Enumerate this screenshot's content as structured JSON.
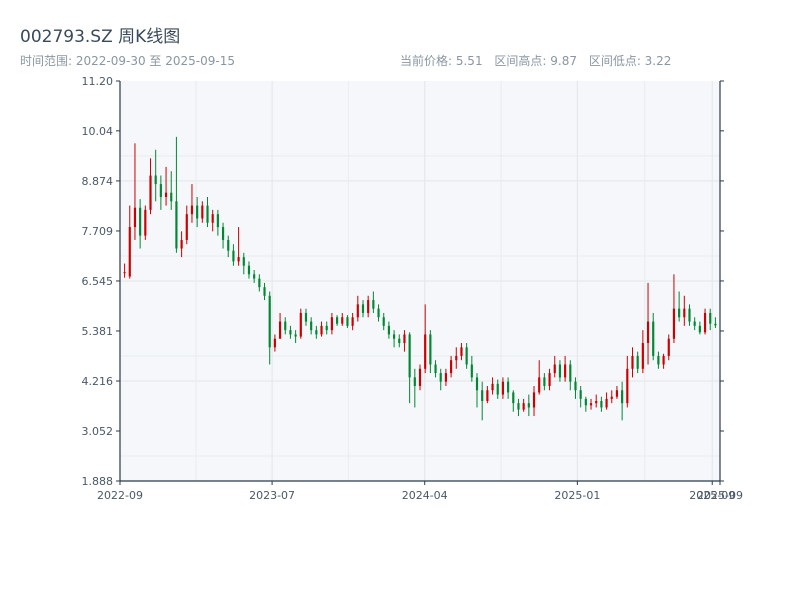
{
  "header": {
    "title": "002793.SZ 周K线图",
    "range_text": "时间范围: 2022-09-30 至 2025-09-15",
    "current_price_text": "当前价格: 5.51",
    "high_text": "区间高点: 9.87",
    "low_text": "区间低点: 3.22"
  },
  "chart_data": {
    "type": "candlestick",
    "title": "002793.SZ 周K线图",
    "xlabel": "",
    "ylabel": "",
    "ylim": [
      1.888,
      11.2
    ],
    "yticks": [
      1.888,
      3.052,
      4.216,
      5.381,
      6.545,
      7.709,
      8.874,
      10.04,
      11.2
    ],
    "ytick_labels": [
      "1.888",
      "3.052",
      "4.216",
      "5.381",
      "6.545",
      "7.709",
      "8.874",
      "10.04",
      "11.20"
    ],
    "date_range": [
      "2022-09-30",
      "2025-09-15"
    ],
    "xticks": [
      {
        "date": "2022-09-30",
        "label": "2022-09"
      },
      {
        "date": "2023-07-01",
        "label": "2023-07"
      },
      {
        "date": "2024-04-01",
        "label": "2024-04"
      },
      {
        "date": "2025-01-01",
        "label": "2025-01"
      },
      {
        "date": "2025-09-01",
        "label": "2025-09"
      },
      {
        "date": "2025-09-15",
        "label": "2025-09"
      }
    ],
    "up_color": "#cc0000",
    "down_color": "#008833",
    "grid": true,
    "candles": [
      [
        6.75,
        6.95,
        6.75,
        6.62
      ],
      [
        6.65,
        8.3,
        7.8,
        6.6
      ],
      [
        7.8,
        9.75,
        8.25,
        7.5
      ],
      [
        8.25,
        8.45,
        7.6,
        7.3
      ],
      [
        7.6,
        8.3,
        8.2,
        7.5
      ],
      [
        8.2,
        9.4,
        9.0,
        8.1
      ],
      [
        9.0,
        9.6,
        8.8,
        8.4
      ],
      [
        8.8,
        9.0,
        8.5,
        8.2
      ],
      [
        8.5,
        9.2,
        8.6,
        8.3
      ],
      [
        8.6,
        9.1,
        8.4,
        8.2
      ],
      [
        8.4,
        9.9,
        7.3,
        7.2
      ],
      [
        7.3,
        7.7,
        7.5,
        7.1
      ],
      [
        7.5,
        8.3,
        8.1,
        7.4
      ],
      [
        8.1,
        8.8,
        8.3,
        7.9
      ],
      [
        8.3,
        8.5,
        8.0,
        7.8
      ],
      [
        8.0,
        8.4,
        8.3,
        7.9
      ],
      [
        8.3,
        8.5,
        7.9,
        7.8
      ],
      [
        7.9,
        8.2,
        8.1,
        7.7
      ],
      [
        8.1,
        8.2,
        7.8,
        7.6
      ],
      [
        7.8,
        7.9,
        7.5,
        7.3
      ],
      [
        7.5,
        7.6,
        7.25,
        7.1
      ],
      [
        7.25,
        7.4,
        7.0,
        6.9
      ],
      [
        7.0,
        7.8,
        7.1,
        6.9
      ],
      [
        7.1,
        7.2,
        6.9,
        6.7
      ],
      [
        6.9,
        7.0,
        6.7,
        6.6
      ],
      [
        6.7,
        6.8,
        6.6,
        6.5
      ],
      [
        6.6,
        6.7,
        6.4,
        6.3
      ],
      [
        6.4,
        6.5,
        6.2,
        6.1
      ],
      [
        6.2,
        6.3,
        5.0,
        4.6
      ],
      [
        5.0,
        5.3,
        5.2,
        4.9
      ],
      [
        5.2,
        5.8,
        5.6,
        5.2
      ],
      [
        5.6,
        5.7,
        5.4,
        5.3
      ],
      [
        5.4,
        5.5,
        5.3,
        5.2
      ],
      [
        5.3,
        5.4,
        5.25,
        5.1
      ],
      [
        5.25,
        5.9,
        5.8,
        5.2
      ],
      [
        5.8,
        5.9,
        5.6,
        5.5
      ],
      [
        5.6,
        5.7,
        5.4,
        5.3
      ],
      [
        5.4,
        5.5,
        5.3,
        5.2
      ],
      [
        5.3,
        5.6,
        5.5,
        5.25
      ],
      [
        5.5,
        5.6,
        5.4,
        5.3
      ],
      [
        5.4,
        5.8,
        5.7,
        5.3
      ],
      [
        5.7,
        5.75,
        5.55,
        5.5
      ],
      [
        5.55,
        5.8,
        5.7,
        5.5
      ],
      [
        5.7,
        5.75,
        5.5,
        5.45
      ],
      [
        5.5,
        5.8,
        5.7,
        5.4
      ],
      [
        5.7,
        6.2,
        6.0,
        5.6
      ],
      [
        6.0,
        6.1,
        5.8,
        5.7
      ],
      [
        5.8,
        6.2,
        6.1,
        5.7
      ],
      [
        6.1,
        6.3,
        5.9,
        5.8
      ],
      [
        5.9,
        6.0,
        5.7,
        5.6
      ],
      [
        5.7,
        5.8,
        5.5,
        5.4
      ],
      [
        5.5,
        5.6,
        5.3,
        5.2
      ],
      [
        5.3,
        5.4,
        5.2,
        5.0
      ],
      [
        5.2,
        5.3,
        5.1,
        5.0
      ],
      [
        5.1,
        5.4,
        5.3,
        4.9
      ],
      [
        5.3,
        5.35,
        4.3,
        3.7
      ],
      [
        4.3,
        4.5,
        4.1,
        3.6
      ],
      [
        4.1,
        4.6,
        4.5,
        4.0
      ],
      [
        4.5,
        6.0,
        5.3,
        4.4
      ],
      [
        5.3,
        5.4,
        4.6,
        4.4
      ],
      [
        4.6,
        4.7,
        4.4,
        4.3
      ],
      [
        4.4,
        4.5,
        4.2,
        4.0
      ],
      [
        4.2,
        4.5,
        4.4,
        4.1
      ],
      [
        4.4,
        4.8,
        4.7,
        4.3
      ],
      [
        4.7,
        5.0,
        4.8,
        4.5
      ],
      [
        4.8,
        5.1,
        5.0,
        4.7
      ],
      [
        5.0,
        5.1,
        4.6,
        4.5
      ],
      [
        4.6,
        4.8,
        4.3,
        4.2
      ],
      [
        4.3,
        4.4,
        4.0,
        3.6
      ],
      [
        4.0,
        4.2,
        3.75,
        3.3
      ],
      [
        3.75,
        4.1,
        4.0,
        3.7
      ],
      [
        4.0,
        4.3,
        4.15,
        3.9
      ],
      [
        4.15,
        4.25,
        3.9,
        3.8
      ],
      [
        3.9,
        4.3,
        4.2,
        3.8
      ],
      [
        4.2,
        4.3,
        3.95,
        3.8
      ],
      [
        3.95,
        4.0,
        3.7,
        3.5
      ],
      [
        3.7,
        3.8,
        3.55,
        3.4
      ],
      [
        3.55,
        3.8,
        3.7,
        3.5
      ],
      [
        3.7,
        3.9,
        3.6,
        3.4
      ],
      [
        3.6,
        4.1,
        3.95,
        3.4
      ],
      [
        3.95,
        4.7,
        4.3,
        3.9
      ],
      [
        4.3,
        4.4,
        4.1,
        4.0
      ],
      [
        4.1,
        4.5,
        4.4,
        4.0
      ],
      [
        4.4,
        4.8,
        4.6,
        4.3
      ],
      [
        4.6,
        4.7,
        4.3,
        4.2
      ],
      [
        4.3,
        4.8,
        4.6,
        4.2
      ],
      [
        4.6,
        4.7,
        4.2,
        4.0
      ],
      [
        4.2,
        4.3,
        4.0,
        3.8
      ],
      [
        4.0,
        4.1,
        3.8,
        3.6
      ],
      [
        3.8,
        3.85,
        3.65,
        3.5
      ],
      [
        3.65,
        3.8,
        3.7,
        3.55
      ],
      [
        3.7,
        3.9,
        3.75,
        3.6
      ],
      [
        3.75,
        3.85,
        3.6,
        3.5
      ],
      [
        3.6,
        3.95,
        3.8,
        3.55
      ],
      [
        3.8,
        4.0,
        3.85,
        3.7
      ],
      [
        3.85,
        4.1,
        4.0,
        3.8
      ],
      [
        4.0,
        4.2,
        3.7,
        3.3
      ],
      [
        3.7,
        4.8,
        4.5,
        3.6
      ],
      [
        4.5,
        5.0,
        4.8,
        4.3
      ],
      [
        4.8,
        4.9,
        4.5,
        4.4
      ],
      [
        4.5,
        5.4,
        5.1,
        4.4
      ],
      [
        5.1,
        6.5,
        5.6,
        4.6
      ],
      [
        5.6,
        5.8,
        4.8,
        4.7
      ],
      [
        4.8,
        4.9,
        4.6,
        4.5
      ],
      [
        4.6,
        4.85,
        4.8,
        4.5
      ],
      [
        4.8,
        5.3,
        5.2,
        4.7
      ],
      [
        5.2,
        6.7,
        5.9,
        5.1
      ],
      [
        5.9,
        6.3,
        5.7,
        5.6
      ],
      [
        5.7,
        6.2,
        5.9,
        5.5
      ],
      [
        5.9,
        6.0,
        5.6,
        5.5
      ],
      [
        5.6,
        5.7,
        5.5,
        5.4
      ],
      [
        5.5,
        5.6,
        5.35,
        5.3
      ],
      [
        5.35,
        5.9,
        5.8,
        5.3
      ],
      [
        5.8,
        5.9,
        5.55,
        5.4
      ],
      [
        5.55,
        5.7,
        5.51,
        5.45
      ]
    ]
  }
}
